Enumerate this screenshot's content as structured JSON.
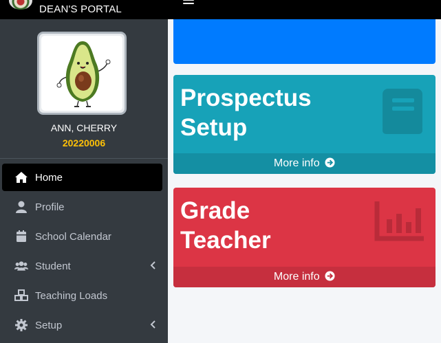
{
  "brand": {
    "title": "DEAN'S PORTAL",
    "logo_icon": "seal-logo"
  },
  "navbar": {
    "menu_icon": "hamburger-icon"
  },
  "user": {
    "name": "ANN, CHERRY",
    "id": "20220006",
    "avatar_icon": "avocado-avatar"
  },
  "sidebar": {
    "items": [
      {
        "label": "Home",
        "icon": "home-icon",
        "active": true
      },
      {
        "label": "Profile",
        "icon": "user-icon"
      },
      {
        "label": "School Calendar",
        "icon": "calendar-icon"
      },
      {
        "label": "Student",
        "icon": "users-icon",
        "has_submenu": true
      },
      {
        "label": "Teaching Loads",
        "icon": "cubes-icon"
      },
      {
        "label": "Setup",
        "icon": "gear-icon",
        "has_submenu": true
      }
    ]
  },
  "cards": [
    {
      "title_line1": "Prospectus",
      "title_line2": "Setup",
      "footer": "More info",
      "icon": "book-icon",
      "color": "#17a2b8"
    },
    {
      "title_line1": "Grade",
      "title_line2": "Teacher",
      "footer": "More info",
      "icon": "chart-icon",
      "color": "#dc3545"
    }
  ],
  "colors": {
    "banner": "#007bff",
    "sidebar": "#343a40",
    "accent_id": "#ffc107"
  }
}
